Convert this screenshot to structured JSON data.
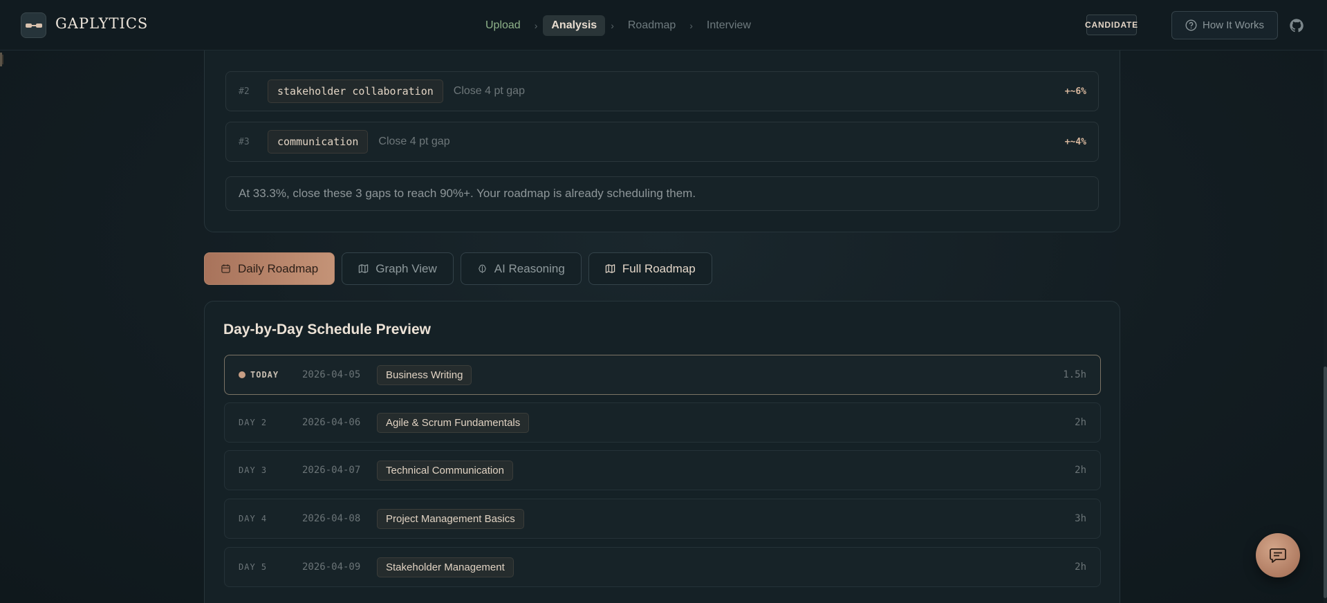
{
  "brand": {
    "name": "GAPLYTICS",
    "logo_icon": "toggle-logo-icon"
  },
  "steps": [
    {
      "label": "Upload",
      "state": "done"
    },
    {
      "label": "Analysis",
      "state": "active"
    },
    {
      "label": "Roadmap",
      "state": "pending"
    },
    {
      "label": "Interview",
      "state": "pending"
    }
  ],
  "header": {
    "mode_label": "CANDIDATE",
    "how_label": "How It Works",
    "github_icon": "github-icon"
  },
  "gaps": {
    "rows": [
      {
        "rank": "#2",
        "skill": "stakeholder collaboration",
        "desc": "Close 4 pt gap",
        "delta": "+~6%"
      },
      {
        "rank": "#3",
        "skill": "communication",
        "desc": "Close 4 pt gap",
        "delta": "+~4%"
      }
    ],
    "summary": "At 33.3%, close these 3 gaps to reach 90%+. Your roadmap is already scheduling them."
  },
  "tabs": [
    {
      "label": "Daily Roadmap",
      "icon": "calendar-icon"
    },
    {
      "label": "Graph View",
      "icon": "map-icon"
    },
    {
      "label": "AI Reasoning",
      "icon": "brain-icon"
    },
    {
      "label": "Full Roadmap",
      "icon": "map-icon"
    }
  ],
  "schedule": {
    "title": "Day-by-Day Schedule Preview",
    "days": [
      {
        "label": "TODAY",
        "date": "2026-04-05",
        "topic": "Business Writing",
        "hours": "1.5h"
      },
      {
        "label": "DAY 2",
        "date": "2026-04-06",
        "topic": "Agile & Scrum Fundamentals",
        "hours": "2h"
      },
      {
        "label": "DAY 3",
        "date": "2026-04-07",
        "topic": "Technical Communication",
        "hours": "2h"
      },
      {
        "label": "DAY 4",
        "date": "2026-04-08",
        "topic": "Project Management Basics",
        "hours": "3h"
      },
      {
        "label": "DAY 5",
        "date": "2026-04-09",
        "topic": "Stakeholder Management",
        "hours": "2h"
      }
    ]
  },
  "colors": {
    "accent": "#c49377",
    "background": "#131d22",
    "done_step": "#8fb38a"
  },
  "fab": {
    "icon": "chat-icon"
  }
}
